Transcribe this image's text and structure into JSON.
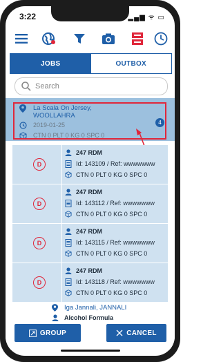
{
  "status": {
    "time": "3:22",
    "icons": "▂▄▆ ᯤ ▭"
  },
  "toolbar": {
    "items": [
      {
        "name": "menu-icon"
      },
      {
        "name": "globe-icon"
      },
      {
        "name": "filter-icon"
      },
      {
        "name": "camera-icon"
      },
      {
        "name": "server-icon"
      },
      {
        "name": "clock-icon"
      }
    ]
  },
  "tabs": {
    "jobs": "JOBS",
    "outbox": "OUTBOX"
  },
  "search": {
    "placeholder": "Search"
  },
  "job": {
    "name": "La Scala On Jersey,",
    "suburb": "WOOLLAHRA",
    "date": "2019-01-25",
    "totals": "CTN 0 PLT 0 KG 0 SPC 0",
    "count": "4"
  },
  "stops": [
    {
      "status": "D",
      "customer": "247 RDM",
      "ref": "Id: 143109 / Ref: wwwwwww",
      "totals": "CTN 0 PLT 0 KG 0 SPC 0"
    },
    {
      "status": "D",
      "customer": "247 RDM",
      "ref": "Id: 143112 / Ref: wwwwwww",
      "totals": "CTN 0 PLT 0 KG 0 SPC 0"
    },
    {
      "status": "D",
      "customer": "247 RDM",
      "ref": "Id: 143115 / Ref: wwwwwww",
      "totals": "CTN 0 PLT 0 KG 0 SPC 0"
    },
    {
      "status": "D",
      "customer": "247 RDM",
      "ref": "Id: 143118 / Ref: wwwwwww",
      "totals": "CTN 0 PLT 0 KG 0 SPC 0"
    }
  ],
  "next_job": {
    "name": "Iga Jannali, JANNALI",
    "customer": "Alcohol Formula"
  },
  "buttons": {
    "group": "GROUP",
    "cancel": "CANCEL"
  },
  "colors": {
    "primary": "#1f5fa8",
    "highlight": "#e0263a",
    "job_bg": "#9cc0de",
    "stop_bg": "#cfe1f0"
  }
}
